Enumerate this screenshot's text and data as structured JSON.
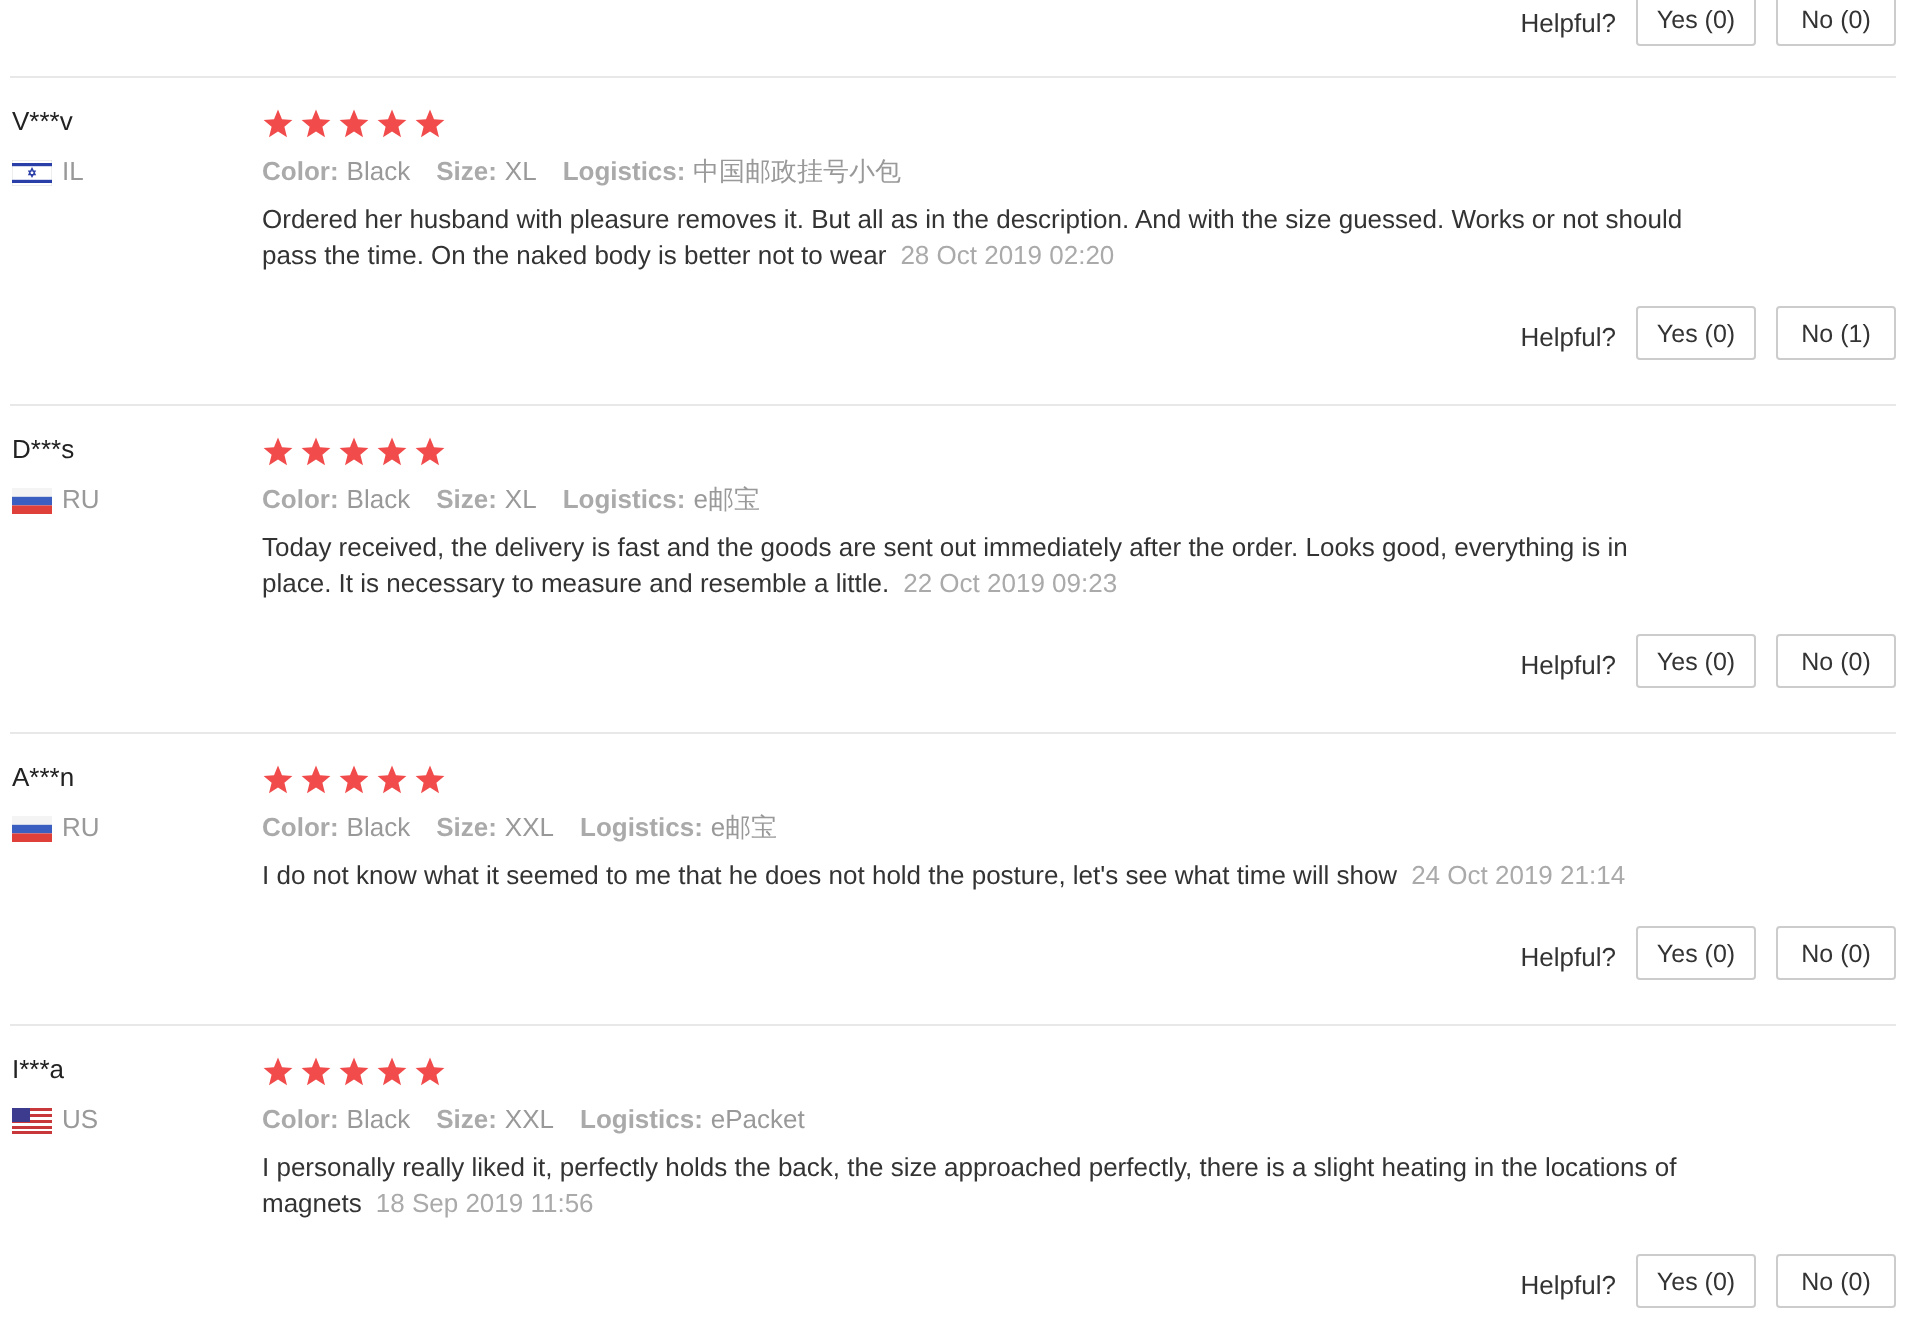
{
  "top_helpful": {
    "label": "Helpful?",
    "yes": "Yes (0)",
    "no": "No (0)"
  },
  "reviews": [
    {
      "name": "V***v",
      "flag": {
        "kind": "israel"
      },
      "country": "IL",
      "stars": 5,
      "color_label": "Color:",
      "product_color": "Black",
      "size_label": "Size:",
      "size": "XL",
      "logistics_label": "Logistics:",
      "logistics": "中国邮政挂号小包",
      "text": "Ordered her husband with pleasure removes it. But all as in the description. And with the size guessed. Works or not should pass the time. On the naked body is better not to wear",
      "date": "28 Oct 2019 02:20",
      "helpful": "Helpful?",
      "yes": "Yes (0)",
      "no": "No (1)"
    },
    {
      "name": "D***s",
      "flag": {
        "kind": "russia"
      },
      "country": "RU",
      "stars": 5,
      "color_label": "Color:",
      "product_color": "Black",
      "size_label": "Size:",
      "size": "XL",
      "logistics_label": "Logistics:",
      "logistics": "e邮宝",
      "text": "Today received, the delivery is fast and the goods are sent out immediately after the order. Looks good, everything is in place. It is necessary to measure and resemble a little.",
      "date": "22 Oct 2019 09:23",
      "helpful": "Helpful?",
      "yes": "Yes (0)",
      "no": "No (0)"
    },
    {
      "name": "A***n",
      "flag": {
        "kind": "russia"
      },
      "country": "RU",
      "stars": 5,
      "color_label": "Color:",
      "product_color": "Black",
      "size_label": "Size:",
      "size": "XXL",
      "logistics_label": "Logistics:",
      "logistics": "e邮宝",
      "text": "I do not know what it seemed to me that he does not hold the posture, let's see what time will show",
      "date": "24 Oct 2019 21:14",
      "helpful": "Helpful?",
      "yes": "Yes (0)",
      "no": "No (0)"
    },
    {
      "name": "I***a",
      "flag": {
        "kind": "usa"
      },
      "country": "US",
      "stars": 5,
      "color_label": "Color:",
      "product_color": "Black",
      "size_label": "Size:",
      "size": "XXL",
      "logistics_label": "Logistics:",
      "logistics": "ePacket",
      "text": "I personally really liked it, perfectly holds the back, the size approached perfectly, there is a slight heating in the locations of magnets",
      "date": "18 Sep 2019 11:56",
      "helpful": "Helpful?",
      "yes": "Yes (0)",
      "no": "No (0)"
    }
  ]
}
